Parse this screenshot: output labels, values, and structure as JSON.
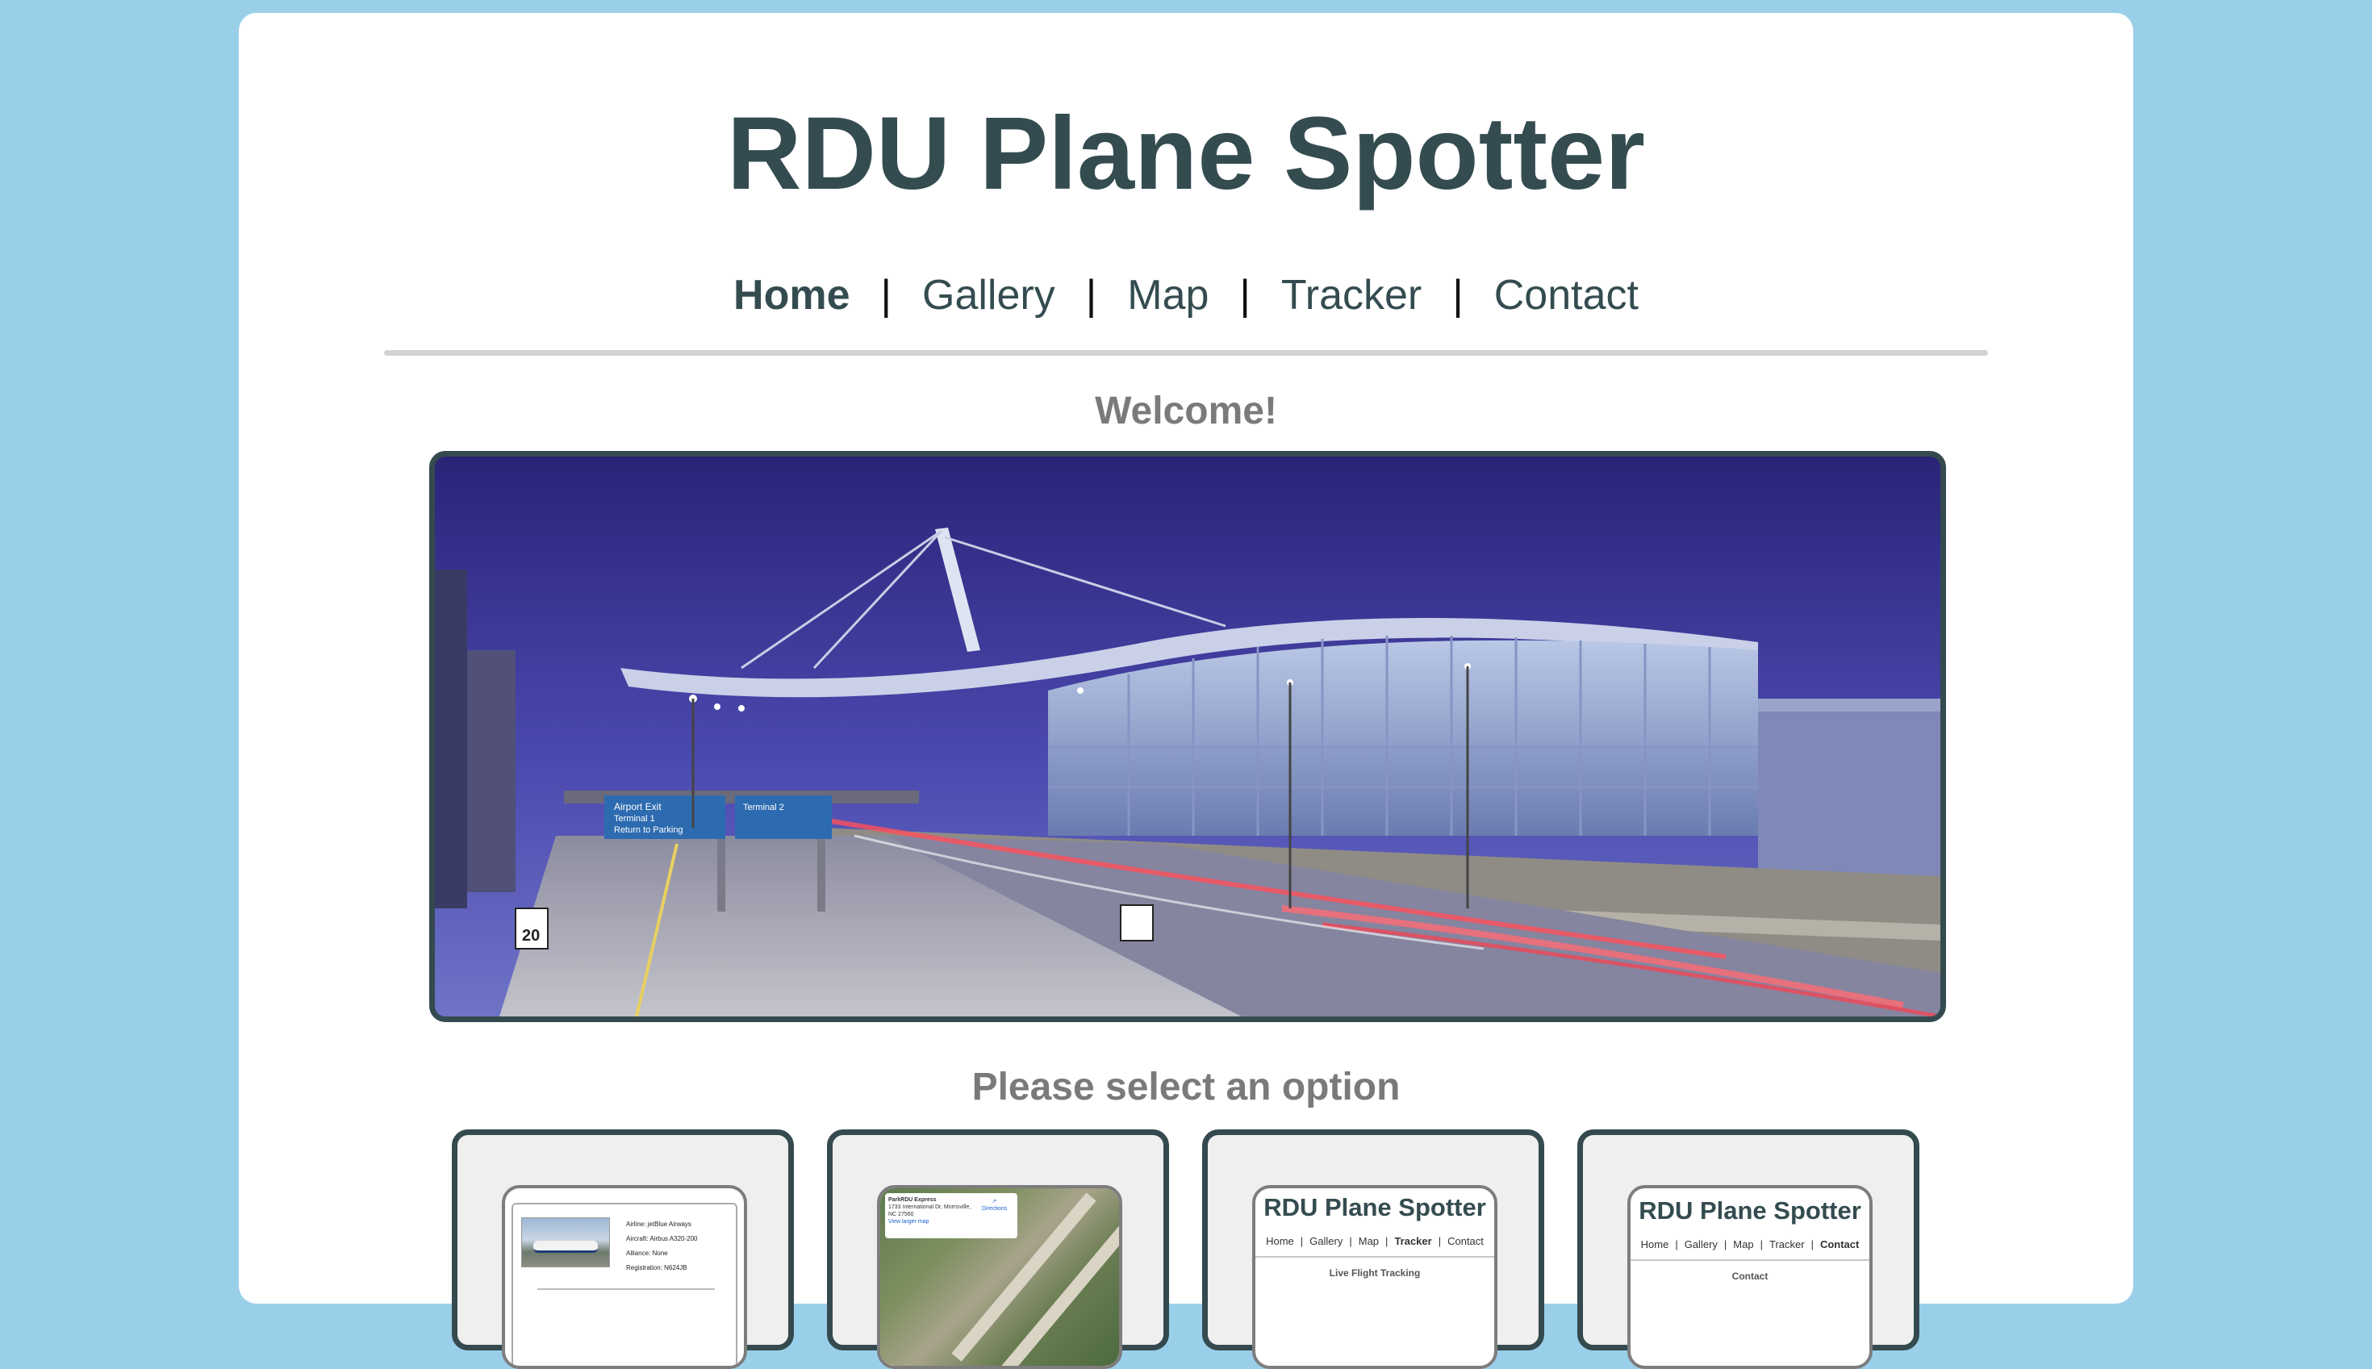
{
  "site": {
    "title": "RDU Plane Spotter",
    "welcome": "Welcome!",
    "prompt": "Please select an option"
  },
  "nav": {
    "items": [
      {
        "label": "Home",
        "active": true
      },
      {
        "label": "Gallery",
        "active": false
      },
      {
        "label": "Map",
        "active": false
      },
      {
        "label": "Tracker",
        "active": false
      },
      {
        "label": "Contact",
        "active": false
      }
    ],
    "separator": "|"
  },
  "hero": {
    "signs": [
      "Airport Exit",
      "Terminal 1",
      "Return to Parking",
      "Terminal 2"
    ],
    "speed_limit": "20"
  },
  "options": {
    "gallery": {
      "airline": "Airline: jetBlue Airways",
      "aircraft": "Aircraft: Airbus A320-200",
      "alliance": "Alliance: None",
      "registration": "Registration: N624JB"
    },
    "map": {
      "place": "ParkRDU Express",
      "address_1": "1733 International Dr, Morrisville,",
      "address_2": "NC 27560",
      "link": "View larger map",
      "directions": "Directions"
    },
    "tracker": {
      "title": "RDU Plane Spotter",
      "nav": [
        "Home",
        "Gallery",
        "Map",
        "Tracker",
        "Contact"
      ],
      "nav_active": "Tracker",
      "subtitle": "Live Flight Tracking"
    },
    "contact": {
      "title": "RDU Plane Spotter",
      "nav": [
        "Home",
        "Gallery",
        "Map",
        "Tracker",
        "Contact"
      ],
      "nav_active": "Contact",
      "subtitle": "Contact"
    }
  },
  "colors": {
    "background": "#9acfea",
    "card": "#ffffff",
    "title": "#344c50",
    "muted": "#7a7a7a",
    "frame": "#354a4e"
  }
}
